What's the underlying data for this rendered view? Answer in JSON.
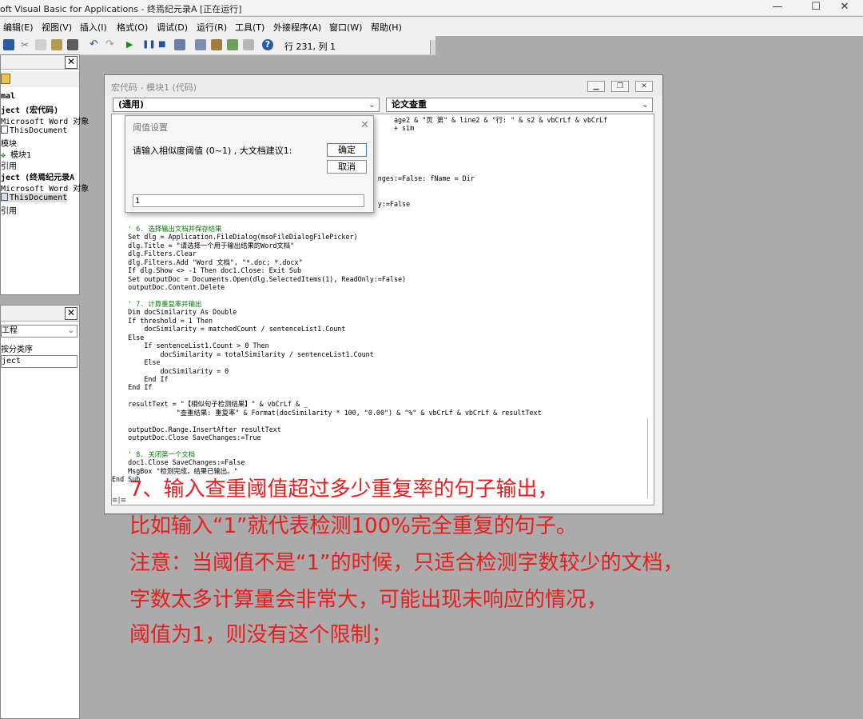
{
  "window": {
    "title": "oft Visual Basic for Applications - 终焉纪元录A [正在运行]"
  },
  "menu": [
    "编辑(E)",
    "视图(V)",
    "插入(I)",
    "格式(O)",
    "调试(D)",
    "运行(R)",
    "工具(T)",
    "外接程序(A)",
    "窗口(W)",
    "帮助(H)"
  ],
  "toolbar": {
    "position": "行 231, 列 1"
  },
  "project": {
    "items": [
      "mal",
      "ject (宏代码)",
      "Microsoft Word 对象",
      "ThisDocument",
      "模块",
      "模块1",
      "引用",
      "ject (终焉纪元录A",
      "Microsoft Word 对象",
      "ThisDocument",
      "引用"
    ]
  },
  "properties": {
    "combo": "工程",
    "tabs": "按分类序",
    "items": [
      "ject"
    ]
  },
  "codewin": {
    "title": "宏代码 - 模块1 (代码)",
    "object_combo": "(通用)",
    "proc_combo": "论文查重",
    "lines": [
      {
        "text": "                                                                      age2 & \"页 第\" & line2 & \"行: \" & s2 & vbCrLf & vbCrLf",
        "cls": ""
      },
      {
        "text": "                                                                      + sim",
        "cls": ""
      },
      {
        "text": "",
        "cls": ""
      },
      {
        "text": "",
        "cls": ""
      },
      {
        "text": "",
        "cls": ""
      },
      {
        "text": "",
        "cls": ""
      },
      {
        "text": "",
        "cls": ""
      },
      {
        "text": "                                                                  nges:=False: fName = Dir",
        "cls": ""
      },
      {
        "text": "",
        "cls": ""
      },
      {
        "text": "",
        "cls": ""
      },
      {
        "text": "                                                                  y:=False",
        "cls": ""
      },
      {
        "text": "",
        "cls": ""
      },
      {
        "text": "",
        "cls": ""
      },
      {
        "text": "    ' 6. 选择输出文档并保存结果",
        "cls": "cm"
      },
      {
        "text": "    Set dlg = Application.FileDialog(msoFileDialogFilePicker)",
        "cls": ""
      },
      {
        "text": "    dlg.Title = \"请选择一个用于输出结果的Word文档\"",
        "cls": ""
      },
      {
        "text": "    dlg.Filters.Clear",
        "cls": ""
      },
      {
        "text": "    dlg.Filters.Add \"Word 文档\", \"*.doc; *.docx\"",
        "cls": ""
      },
      {
        "text": "    If dlg.Show <> -1 Then doc1.Close: Exit Sub",
        "cls": ""
      },
      {
        "text": "    Set outputDoc = Documents.Open(dlg.SelectedItems(1), ReadOnly:=False)",
        "cls": ""
      },
      {
        "text": "    outputDoc.Content.Delete",
        "cls": ""
      },
      {
        "text": "",
        "cls": ""
      },
      {
        "text": "    ' 7. 计算重复率并输出",
        "cls": "cm"
      },
      {
        "text": "    Dim docSimilarity As Double",
        "cls": ""
      },
      {
        "text": "    If threshold = 1 Then",
        "cls": ""
      },
      {
        "text": "        docSimilarity = matchedCount / sentenceList1.Count",
        "cls": ""
      },
      {
        "text": "    Else",
        "cls": ""
      },
      {
        "text": "        If sentenceList1.Count > 0 Then",
        "cls": ""
      },
      {
        "text": "            docSimilarity = totalSimilarity / sentenceList1.Count",
        "cls": ""
      },
      {
        "text": "        Else",
        "cls": ""
      },
      {
        "text": "            docSimilarity = 0",
        "cls": ""
      },
      {
        "text": "        End If",
        "cls": ""
      },
      {
        "text": "    End If",
        "cls": ""
      },
      {
        "text": "",
        "cls": ""
      },
      {
        "text": "    resultText = \"【相似句子检测结果】\" & vbCrLf & _",
        "cls": ""
      },
      {
        "text": "                \"查重结果: 重复率\" & Format(docSimilarity * 100, \"0.00\") & \"%\" & vbCrLf & vbCrLf & resultText",
        "cls": ""
      },
      {
        "text": "",
        "cls": ""
      },
      {
        "text": "    outputDoc.Range.InsertAfter resultText",
        "cls": ""
      },
      {
        "text": "    outputDoc.Close SaveChanges:=True",
        "cls": ""
      },
      {
        "text": "",
        "cls": ""
      },
      {
        "text": "    ' 8. 关闭第一个文档",
        "cls": "cm"
      },
      {
        "text": "    doc1.Close SaveChanges:=False",
        "cls": ""
      },
      {
        "text": "    MsgBox \"检测完成，结果已输出。\"",
        "cls": ""
      },
      {
        "text": "End Sub",
        "cls": ""
      }
    ]
  },
  "dialog": {
    "title": "阈值设置",
    "prompt": "请输入相似度阈值 (0~1) , 大文档建议1:",
    "ok": "确定",
    "cancel": "取消",
    "value": "1"
  },
  "annotation": [
    "7、输入查重阈值超过多少重复率的句子输出，",
    "比如输入“1”就代表检测100%完全重复的句子。",
    "注意：当阈值不是“1”的时候，只适合检测字数较少的文档，",
    "字数太多计算量会非常大，可能出现未响应的情况，",
    "阈值为1，则没有这个限制；"
  ]
}
